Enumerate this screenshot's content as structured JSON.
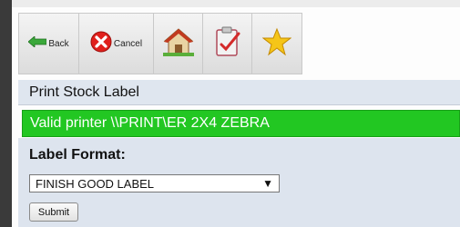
{
  "toolbar": {
    "back_label": "Back",
    "cancel_label": "Cancel",
    "home_icon": "home-icon",
    "checklist_icon": "checklist-icon",
    "star_icon": "star-icon"
  },
  "page": {
    "title": "Print Stock Label"
  },
  "status": {
    "message": "Valid printer \\\\PRINT\\ER 2X4 ZEBRA",
    "color": "#22c722"
  },
  "form": {
    "format_label": "Label Format:",
    "format_selected": "FINISH GOOD LABEL",
    "submit_label": "Submit"
  }
}
